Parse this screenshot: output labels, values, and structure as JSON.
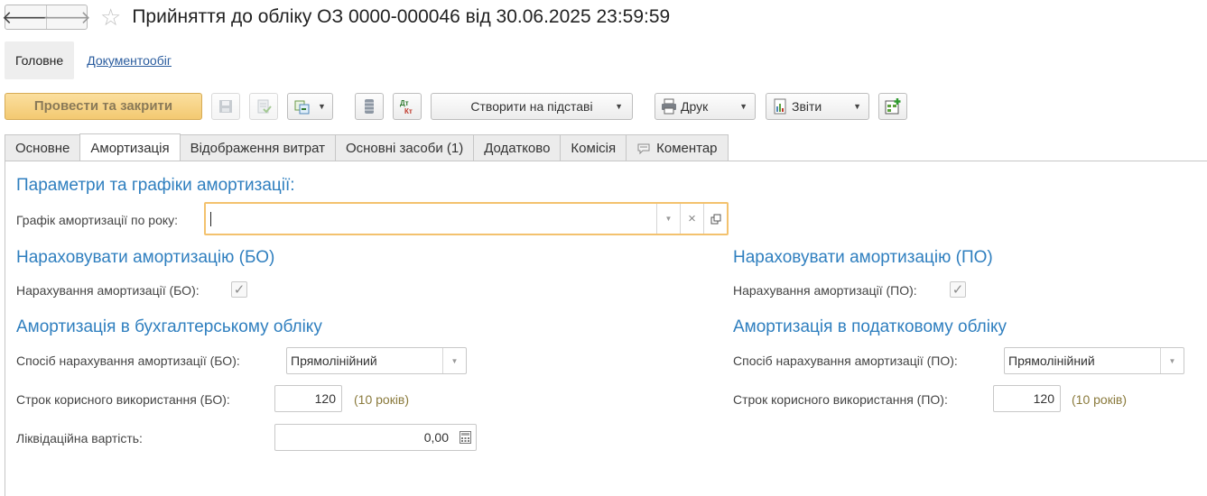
{
  "window": {
    "title": "Прийняття до обліку ОЗ 0000-000046 від 30.06.2025 23:59:59",
    "back_glyph": "🡐",
    "forward_glyph": "🡒",
    "star_glyph": "☆"
  },
  "sections": {
    "main": "Головне",
    "workflow": "Документообіг"
  },
  "toolbar": {
    "post_close": "Провести та закрити",
    "create_based": "Створити на підставі",
    "print": "Друк",
    "reports": "Звіти",
    "dropdown_glyph": "▼"
  },
  "tabs": [
    {
      "label": "Основне"
    },
    {
      "label": "Амортизація",
      "active": true
    },
    {
      "label": "Відображення витрат"
    },
    {
      "label": "Основні засоби (1)"
    },
    {
      "label": "Додатково"
    },
    {
      "label": "Комісія"
    },
    {
      "label": "Коментар"
    }
  ],
  "form": {
    "params_heading": "Параметри та графіки амортизації:",
    "schedule_label": "Графік амортизації по року:",
    "schedule_value": "",
    "bo": {
      "accrue_heading": "Нараховувати амортизацію (БО)",
      "accrue_label": "Нарахування амортизації (БО):",
      "accrue_checked": true,
      "accounting_heading": "Амортизація в бухгалтерському обліку",
      "method_label": "Спосіб нарахування амортизації (БО):",
      "method_value": "Прямолінійний",
      "term_label": "Строк корисного використання (БО):",
      "term_value": "120",
      "term_hint": "(10 років)",
      "liquidation_label": "Ліквідаційна вартість:",
      "liquidation_value": "0,00"
    },
    "po": {
      "accrue_heading": "Нараховувати амортизацію (ПО)",
      "accrue_label": "Нарахування амортизації (ПО):",
      "accrue_checked": true,
      "accounting_heading": "Амортизація в податковому обліку",
      "method_label": "Спосіб нарахування амортизації (ПО):",
      "method_value": "Прямолінійний",
      "term_label": "Строк корисного використання (ПО):",
      "term_value": "120",
      "term_hint": "(10 років)"
    },
    "check_glyph": "✓",
    "clear_glyph": "×"
  },
  "colors": {
    "heading": "#2f7fbf",
    "primary_button": "#f3c971",
    "focus_border": "#f3c26e",
    "link": "#2a5c9e",
    "hint": "#8a7a3c"
  }
}
